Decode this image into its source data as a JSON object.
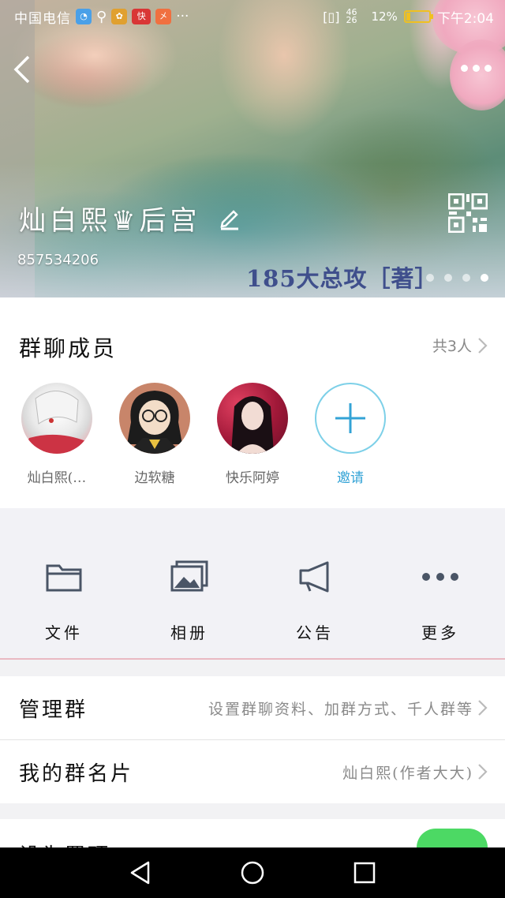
{
  "status_bar": {
    "carrier": "中国电信",
    "network": "46 26",
    "battery_text": "12%",
    "time": "下午2:04",
    "overflow": "···"
  },
  "hero": {
    "group_name": "灿白熙♛后宫",
    "group_id": "857534206",
    "caption": "185大总攻［著］",
    "page_dots": 4,
    "active_dot": 3
  },
  "members": {
    "title": "群聊成员",
    "count_label": "共3人",
    "list": [
      {
        "name": "灿白熙(…",
        "avatar_icon": "anime-avatar"
      },
      {
        "name": "边软糖",
        "avatar_icon": "cartoon-avatar"
      },
      {
        "name": "快乐阿婷",
        "avatar_icon": "portrait-avatar"
      }
    ],
    "invite_label": "邀请"
  },
  "tools": [
    {
      "label": "文件",
      "icon": "folder-icon"
    },
    {
      "label": "相册",
      "icon": "album-icon"
    },
    {
      "label": "公告",
      "icon": "megaphone-icon"
    },
    {
      "label": "更多",
      "icon": "more-dots-icon"
    }
  ],
  "manage": {
    "label": "管理群",
    "value": "设置群聊资料、加群方式、千人群等"
  },
  "card": {
    "label": "我的群名片",
    "value": "灿白熙(作者大大)"
  },
  "partial": {
    "label": "设为置顶",
    "toggle_on": true
  },
  "colors": {
    "accent_blue": "#33a3d6",
    "toggle_green": "#4cd964",
    "caption_blue": "#3f4f8c"
  }
}
